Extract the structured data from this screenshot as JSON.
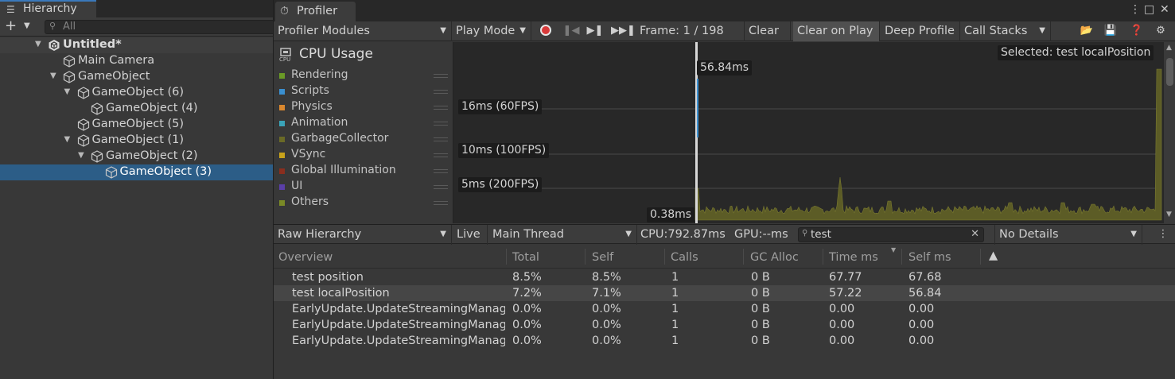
{
  "hierarchy": {
    "tab_label": "Hierarchy",
    "tab_icon": "list-icon",
    "search_placeholder": "All",
    "items": [
      {
        "label": "Untitled*",
        "kind": "scene",
        "depth": 0,
        "expanded": true
      },
      {
        "label": "Main Camera",
        "kind": "object",
        "depth": 1
      },
      {
        "label": "GameObject",
        "kind": "object",
        "depth": 1,
        "expanded": true
      },
      {
        "label": "GameObject (6)",
        "kind": "object",
        "depth": 2,
        "expanded": true
      },
      {
        "label": "GameObject (4)",
        "kind": "object",
        "depth": 3
      },
      {
        "label": "GameObject (5)",
        "kind": "object",
        "depth": 2
      },
      {
        "label": "GameObject (1)",
        "kind": "object",
        "depth": 2,
        "expanded": true
      },
      {
        "label": "GameObject (2)",
        "kind": "object",
        "depth": 3,
        "expanded": true
      },
      {
        "label": "GameObject (3)",
        "kind": "object",
        "depth": 4,
        "selected": true
      }
    ]
  },
  "profiler": {
    "tab_label": "Profiler",
    "toolbar": {
      "modules_dropdown": "Profiler Modules",
      "target_dropdown": "Play Mode",
      "frame_label": "Frame: 1 / 198",
      "clear": "Clear",
      "clear_on_play": "Clear on Play",
      "deep_profile": "Deep Profile",
      "call_stacks": "Call Stacks"
    },
    "cpu_module": {
      "title": "CPU Usage",
      "categories": [
        {
          "label": "Rendering",
          "color": "#6a9a26"
        },
        {
          "label": "Scripts",
          "color": "#3a8fd0"
        },
        {
          "label": "Physics",
          "color": "#d9872e"
        },
        {
          "label": "Animation",
          "color": "#3aa3b8"
        },
        {
          "label": "GarbageCollector",
          "color": "#6a6a26"
        },
        {
          "label": "VSync",
          "color": "#c7a21b"
        },
        {
          "label": "Global Illumination",
          "color": "#8a2e1e"
        },
        {
          "label": "UI",
          "color": "#5a3fa8"
        },
        {
          "label": "Others",
          "color": "#7a8a26"
        }
      ]
    },
    "chart": {
      "selected_label": "Selected: test localPosition",
      "selected_value": "56.84ms",
      "min_label": "0.38ms",
      "guides": [
        {
          "label": "16ms (60FPS)",
          "ms": 16
        },
        {
          "label": "10ms (100FPS)",
          "ms": 10
        },
        {
          "label": "5ms (200FPS)",
          "ms": 5
        }
      ],
      "fill_color": "#5c5c26"
    },
    "details": {
      "view_dropdown": "Raw Hierarchy",
      "live": "Live",
      "thread_dropdown": "Main Thread",
      "cpu": "CPU:792.87ms",
      "gpu": "GPU:--ms",
      "search_value": "test",
      "details_dropdown": "No Details",
      "columns": [
        "Overview",
        "Total",
        "Self",
        "Calls",
        "GC Alloc",
        "Time ms",
        "Self ms"
      ],
      "rows": [
        [
          "test position",
          "8.5%",
          "8.5%",
          "1",
          "0 B",
          "67.77",
          "67.68"
        ],
        [
          "test localPosition",
          "7.2%",
          "7.1%",
          "1",
          "0 B",
          "57.22",
          "56.84"
        ],
        [
          "EarlyUpdate.UpdateStreamingManag",
          "0.0%",
          "0.0%",
          "1",
          "0 B",
          "0.00",
          "0.00"
        ],
        [
          "EarlyUpdate.UpdateStreamingManag",
          "0.0%",
          "0.0%",
          "1",
          "0 B",
          "0.00",
          "0.00"
        ],
        [
          "EarlyUpdate.UpdateStreamingManag",
          "0.0%",
          "0.0%",
          "1",
          "0 B",
          "0.00",
          "0.00"
        ]
      ],
      "highlighted_row": 1
    }
  }
}
